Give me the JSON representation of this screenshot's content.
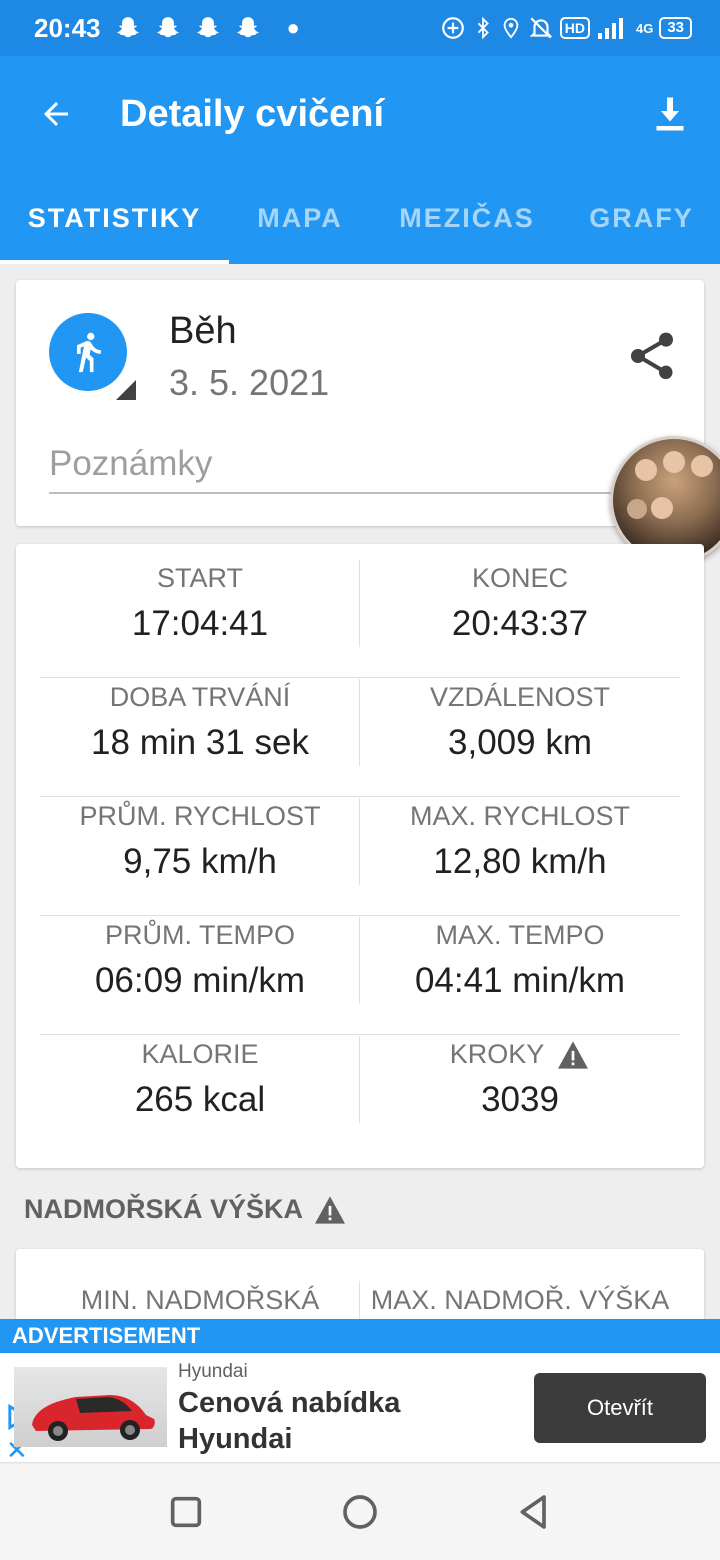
{
  "status_bar": {
    "time": "20:43",
    "hd": "HD",
    "network": "4G",
    "battery": "33"
  },
  "app_bar": {
    "title": "Detaily cvičení"
  },
  "tabs": [
    {
      "label": "STATISTIKY",
      "active": true
    },
    {
      "label": "MAPA",
      "active": false
    },
    {
      "label": "MEZIČAS",
      "active": false
    },
    {
      "label": "GRAFY",
      "active": false
    }
  ],
  "activity": {
    "name": "Běh",
    "date": "3. 5. 2021",
    "notes_placeholder": "Poznámky"
  },
  "stats": [
    {
      "left_label": "START",
      "left_value": "17:04:41",
      "right_label": "KONEC",
      "right_value": "20:43:37"
    },
    {
      "left_label": "DOBA TRVÁNÍ",
      "left_value": "18 min 31 sek",
      "right_label": "VZDÁLENOST",
      "right_value": "3,009 km"
    },
    {
      "left_label": "PRŮM. RYCHLOST",
      "left_value": "9,75 km/h",
      "right_label": "MAX. RYCHLOST",
      "right_value": "12,80 km/h"
    },
    {
      "left_label": "PRŮM. TEMPO",
      "left_value": "06:09 min/km",
      "right_label": "MAX. TEMPO",
      "right_value": "04:41 min/km"
    },
    {
      "left_label": "KALORIE",
      "left_value": "265 kcal",
      "right_label": "KROKY",
      "right_value": "3039"
    }
  ],
  "elevation": {
    "section_title": "NADMOŘSKÁ VÝŠKA",
    "min_label": "MIN. NADMOŘSKÁ",
    "max_label": "MAX. NADMOŘ. VÝŠKA"
  },
  "ad": {
    "banner": "ADVERTISEMENT",
    "advertiser": "Hyundai",
    "headline": "Cenová nabídka Hyundai",
    "cta": "Otevřít"
  },
  "colors": {
    "status_bar": "#1e88e5",
    "app_bar": "#2196f3",
    "accent": "#2196f3"
  }
}
